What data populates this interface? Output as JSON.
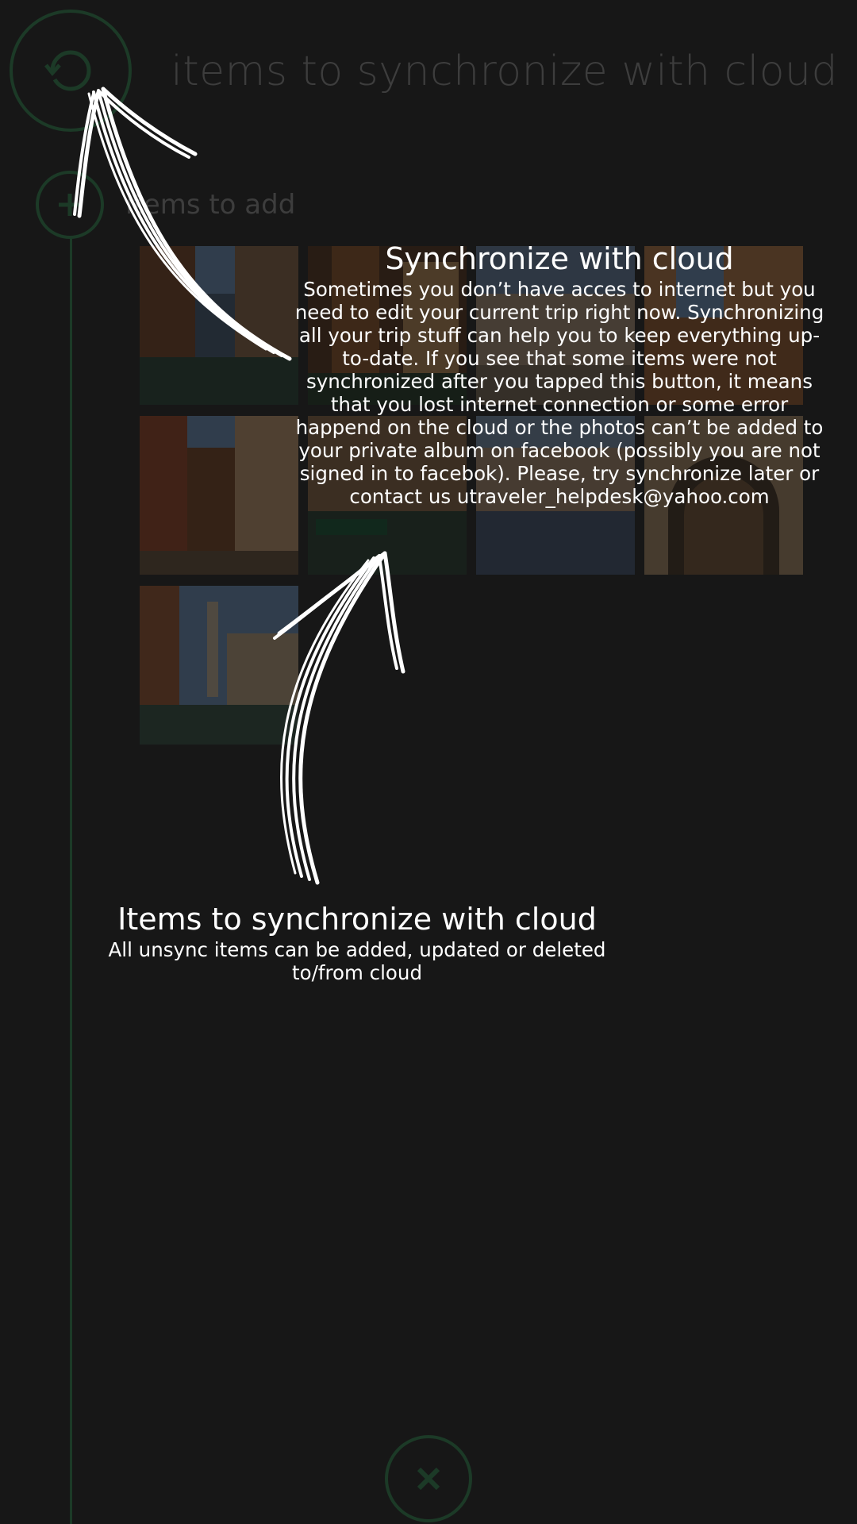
{
  "header": {
    "title": "items to synchronize with cloud",
    "sync_icon": "sync-icon"
  },
  "section": {
    "label": "items to add",
    "add_icon": "plus-icon"
  },
  "photos": [
    {
      "name": "photo-venice-canal-1"
    },
    {
      "name": "photo-venice-canal-2"
    },
    {
      "name": "photo-venice-square-1"
    },
    {
      "name": "photo-venice-building"
    },
    {
      "name": "photo-venice-alley"
    },
    {
      "name": "photo-venice-canal-boats"
    },
    {
      "name": "photo-venice-square-2"
    },
    {
      "name": "photo-venice-arch"
    },
    {
      "name": "photo-venice-campanile"
    }
  ],
  "overlay": {
    "sync_tip": {
      "title": "Synchronize with cloud",
      "body": "Sometimes you don’t have acces to internet but you need to edit your current trip right now. Synchronizing all your trip stuff can help you to keep everything up-to-date. If you see that some items were not synchronized after you tapped this button, it means that you lost internet connection or some error happend on the cloud or the photos can’t be added to your private album on facebook (possibly you are not signed in to facebok). Please, try synchronize later or contact us utraveler_helpdesk@yahoo.com"
    },
    "items_tip": {
      "title": "Items to synchronize with cloud",
      "body": "All unsync items can be added, updated or deleted to/from cloud"
    }
  },
  "footer": {
    "close_icon": "close-icon"
  },
  "colors": {
    "background": "#171717",
    "accent_dim": "#1c3a27",
    "text_dim": "#3d3d3d",
    "overlay_text": "#ffffff"
  }
}
